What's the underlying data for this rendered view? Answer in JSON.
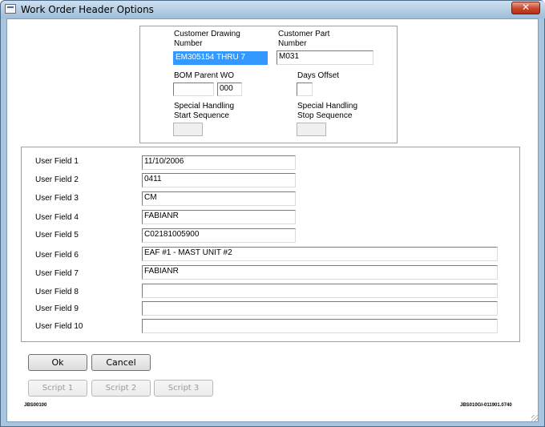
{
  "window": {
    "title": "Work Order Header Options",
    "close_glyph": "✕"
  },
  "header_panel": {
    "customer_drawing_label": "Customer Drawing\nNumber",
    "customer_drawing_value": "EM305154 THRU 7",
    "customer_part_label": "Customer Part\nNumber",
    "customer_part_value": "M031",
    "bom_parent_label": "BOM Parent WO",
    "bom_parent_value_1": "",
    "bom_parent_value_2": "000",
    "days_offset_label": "Days Offset",
    "days_offset_value": "",
    "sh_start_label": "Special Handling\nStart Sequence",
    "sh_start_value": "",
    "sh_stop_label": "Special Handling\nStop Sequence",
    "sh_stop_value": ""
  },
  "user_fields": [
    {
      "label": "User Field 1",
      "value": "11/10/2006"
    },
    {
      "label": "User Field 2",
      "value": "0411"
    },
    {
      "label": "User Field 3",
      "value": "CM"
    },
    {
      "label": "User Field 4",
      "value": "FABIANR"
    },
    {
      "label": "User Field 5",
      "value": "C02181005900"
    },
    {
      "label": "User Field 6",
      "value": "EAF #1 - MAST UNIT #2"
    },
    {
      "label": "User Field 7",
      "value": "FABIANR"
    },
    {
      "label": "User Field 8",
      "value": ""
    },
    {
      "label": "User Field 9",
      "value": ""
    },
    {
      "label": "User Field 10",
      "value": ""
    }
  ],
  "buttons": {
    "ok": "Ok",
    "cancel": "Cancel",
    "script1": "Script 1",
    "script2": "Script 2",
    "script3": "Script 3"
  },
  "footer": {
    "left_code": "JBS00100",
    "right_code": "JBS010GI-011901.0740"
  },
  "colors": {
    "selection": "#3399ff",
    "titlebar": "#a9c5de",
    "close": "#c9452a"
  }
}
